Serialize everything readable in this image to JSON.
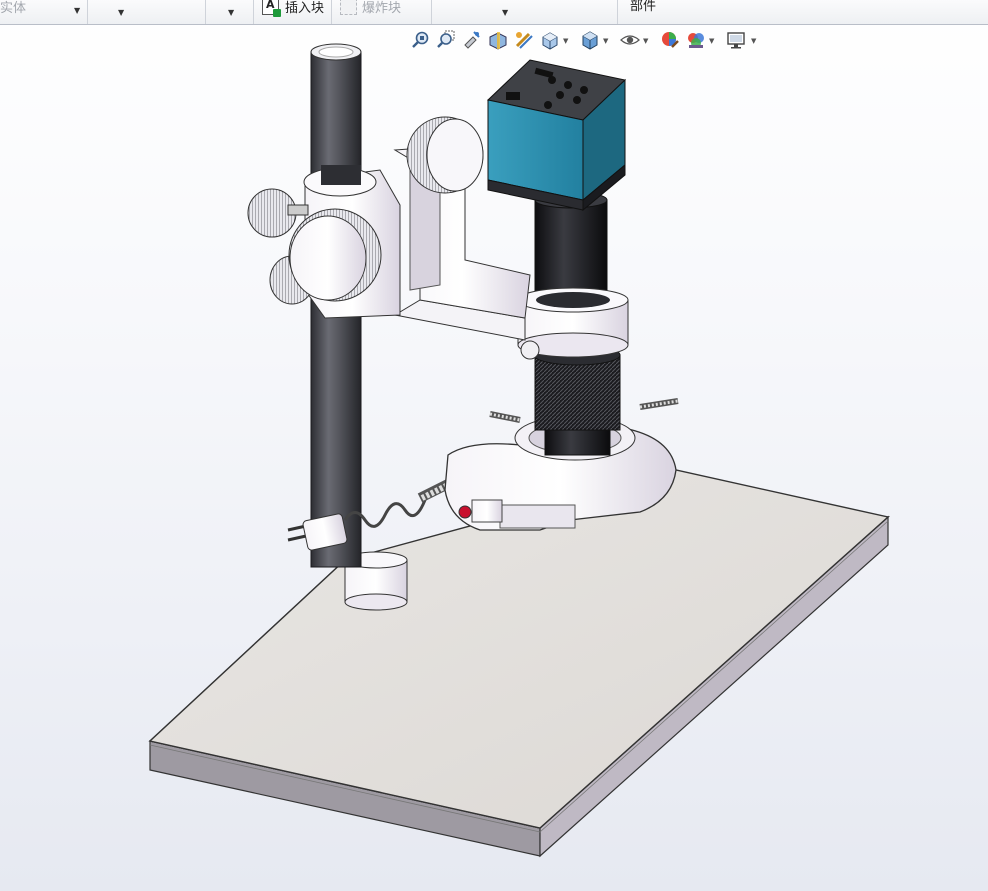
{
  "command_bar": {
    "solid_label": "实体",
    "insert_block_label": "插入块",
    "explode_block_label": "爆炸块",
    "part_label": "部件"
  },
  "view_toolbar": {
    "tools": [
      "zoom-to-fit-icon",
      "zoom-to-area-icon",
      "previous-view-icon",
      "section-view-icon",
      "dynamic-annotation-view-icon",
      "view-orientation-icon",
      "display-style-icon",
      "hide-show-items-icon",
      "edit-appearance-icon",
      "apply-scene-icon",
      "view-settings-icon"
    ]
  },
  "colors": {
    "camera_body": "#2a8aa6",
    "camera_body_dark": "#1d6880",
    "pillar": "#4a4b52",
    "baseplate_top": "#e2dfdc",
    "baseplate_edge": "#c9c3cc",
    "ring_light_indicator": "#c8102e"
  }
}
